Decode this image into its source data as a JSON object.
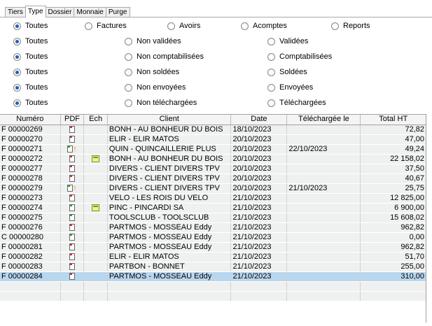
{
  "tabs": [
    "Tiers",
    "Type",
    "Dossier",
    "Monnaie",
    "Purge"
  ],
  "active_tab": "Type",
  "filters": [
    {
      "options": [
        {
          "label": "Toutes",
          "checked": true
        },
        {
          "label": "Factures",
          "checked": false
        },
        {
          "label": "Avoirs",
          "checked": false
        },
        {
          "label": "Acomptes",
          "checked": false
        },
        {
          "label": "Reports",
          "checked": false
        }
      ]
    },
    {
      "options": [
        {
          "label": "Toutes",
          "checked": true
        },
        {
          "label": "Non validées",
          "checked": false
        },
        {
          "label": "Validées",
          "checked": false
        }
      ]
    },
    {
      "options": [
        {
          "label": "Toutes",
          "checked": true
        },
        {
          "label": "Non comptabilisées",
          "checked": false
        },
        {
          "label": "Comptabilisées",
          "checked": false
        }
      ]
    },
    {
      "options": [
        {
          "label": "Toutes",
          "checked": true
        },
        {
          "label": "Non soldées",
          "checked": false
        },
        {
          "label": "Soldées",
          "checked": false
        }
      ]
    },
    {
      "options": [
        {
          "label": "Toutes",
          "checked": true
        },
        {
          "label": "Non envoyées",
          "checked": false
        },
        {
          "label": "Envoyées",
          "checked": false
        }
      ]
    },
    {
      "options": [
        {
          "label": "Toutes",
          "checked": true
        },
        {
          "label": "Non téléchargées",
          "checked": false
        },
        {
          "label": "Téléchargées",
          "checked": false
        }
      ]
    }
  ],
  "table": {
    "columns": [
      "Numéro",
      "PDF",
      "Ech",
      "Client",
      "Date",
      "Téléchargée le",
      "Total HT"
    ],
    "rows": [
      {
        "numero": "F 00000269",
        "pdf": "red",
        "arrow": false,
        "ech": false,
        "client": "BONH - AU BONHEUR DU BOIS",
        "date": "18/10/2023",
        "telechargee": "",
        "total": "72,82",
        "selected": false
      },
      {
        "numero": "F 00000270",
        "pdf": "red",
        "arrow": false,
        "ech": false,
        "client": "ELIR - ELIR MATOS",
        "date": "20/10/2023",
        "telechargee": "",
        "total": "47,00",
        "selected": false
      },
      {
        "numero": "F 00000271",
        "pdf": "green",
        "arrow": true,
        "ech": false,
        "client": "QUIN - QUINCAILLERIE PLUS",
        "date": "20/10/2023",
        "telechargee": "22/10/2023",
        "total": "49,24",
        "selected": false
      },
      {
        "numero": "F 00000272",
        "pdf": "red",
        "arrow": false,
        "ech": true,
        "client": "BONH - AU BONHEUR DU BOIS",
        "date": "20/10/2023",
        "telechargee": "",
        "total": "22 158,02",
        "selected": false
      },
      {
        "numero": "F 00000277",
        "pdf": "red",
        "arrow": false,
        "ech": false,
        "client": "DIVERS - CLIENT DIVERS TPV",
        "date": "20/10/2023",
        "telechargee": "",
        "total": "37,50",
        "selected": false
      },
      {
        "numero": "F 00000278",
        "pdf": "red",
        "arrow": false,
        "ech": false,
        "client": "DIVERS - CLIENT DIVERS TPV",
        "date": "20/10/2023",
        "telechargee": "",
        "total": "40,67",
        "selected": false
      },
      {
        "numero": "F 00000279",
        "pdf": "green",
        "arrow": true,
        "ech": false,
        "client": "DIVERS - CLIENT DIVERS TPV",
        "date": "20/10/2023",
        "telechargee": "21/10/2023",
        "total": "25,75",
        "selected": false
      },
      {
        "numero": "F 00000273",
        "pdf": "red",
        "arrow": false,
        "ech": false,
        "client": "VELO - LES ROIS DU VELO",
        "date": "21/10/2023",
        "telechargee": "",
        "total": "12 825,00",
        "selected": false
      },
      {
        "numero": "F 00000274",
        "pdf": "green",
        "arrow": false,
        "ech": true,
        "client": "PINC - PINCARDI SA",
        "date": "21/10/2023",
        "telechargee": "",
        "total": "6 900,00",
        "selected": false
      },
      {
        "numero": "F 00000275",
        "pdf": "green",
        "arrow": false,
        "ech": false,
        "client": "TOOLSCLUB - TOOLSCLUB",
        "date": "21/10/2023",
        "telechargee": "",
        "total": "15 608,02",
        "selected": false
      },
      {
        "numero": "F 00000276",
        "pdf": "red",
        "arrow": false,
        "ech": false,
        "client": "PARTMOS - MOSSEAU Eddy",
        "date": "21/10/2023",
        "telechargee": "",
        "total": "962,82",
        "selected": false
      },
      {
        "numero": "C 00000280",
        "pdf": "green",
        "arrow": false,
        "ech": false,
        "client": "PARTMOS - MOSSEAU Eddy",
        "date": "21/10/2023",
        "telechargee": "",
        "total": "0,00",
        "selected": false
      },
      {
        "numero": "F 00000281",
        "pdf": "red",
        "arrow": false,
        "ech": false,
        "client": "PARTMOS - MOSSEAU Eddy",
        "date": "21/10/2023",
        "telechargee": "",
        "total": "962,82",
        "selected": false
      },
      {
        "numero": "F 00000282",
        "pdf": "red",
        "arrow": false,
        "ech": false,
        "client": "ELIR - ELIR MATOS",
        "date": "21/10/2023",
        "telechargee": "",
        "total": "51,70",
        "selected": false
      },
      {
        "numero": "F 00000283",
        "pdf": "red",
        "arrow": false,
        "ech": false,
        "client": "PARTBON - BONNET",
        "date": "21/10/2023",
        "telechargee": "",
        "total": "255,00",
        "selected": false
      },
      {
        "numero": "F 00000284",
        "pdf": "red",
        "arrow": false,
        "ech": false,
        "client": "PARTMOS - MOSSEAU Eddy",
        "date": "21/10/2023",
        "telechargee": "",
        "total": "310,00",
        "selected": true
      }
    ]
  },
  "colors": {
    "selected_row": "#b9d6ef",
    "row_bg": "#eef1ef",
    "radio_dot": "#1f5fb5"
  }
}
